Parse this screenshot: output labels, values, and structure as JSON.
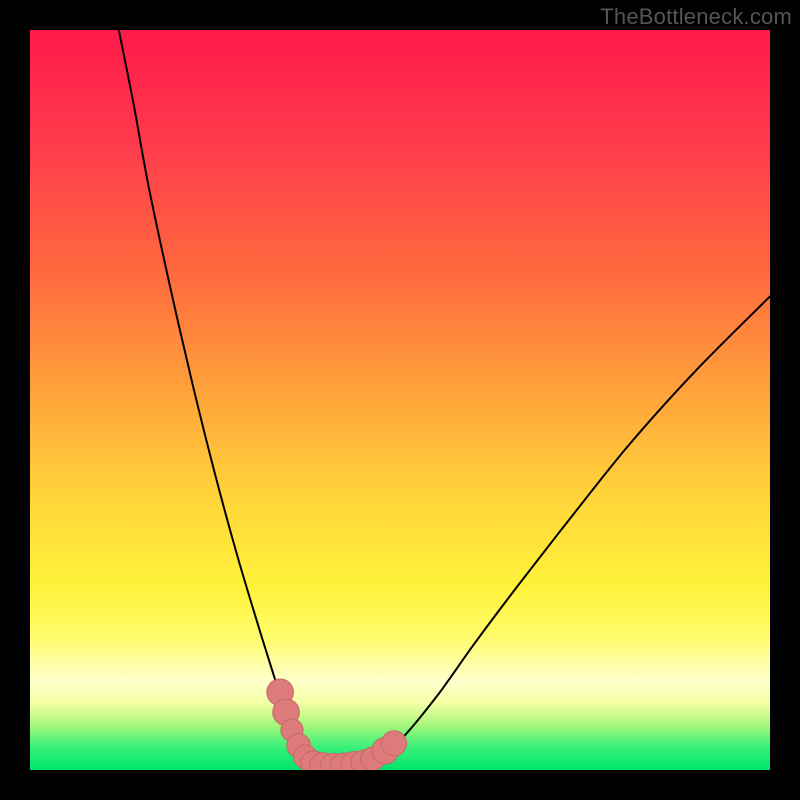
{
  "watermark": "TheBottleneck.com",
  "colors": {
    "curve_stroke": "#000000",
    "beads_fill": "#dd7b7b",
    "beads_stroke": "#c56868"
  },
  "chart_data": {
    "type": "line",
    "title": "",
    "xlabel": "",
    "ylabel": "",
    "xlim": [
      0,
      100
    ],
    "ylim": [
      0,
      100
    ],
    "series": [
      {
        "name": "left-branch",
        "x": [
          12,
          14,
          16,
          19,
          22,
          25,
          28,
          31,
          33.5,
          35,
          36.5,
          38
        ],
        "y": [
          100,
          90,
          79,
          65,
          52,
          40,
          29,
          19,
          11,
          6,
          2.5,
          0.5
        ]
      },
      {
        "name": "valley-floor",
        "x": [
          38,
          40,
          42,
          44,
          46
        ],
        "y": [
          0.5,
          0.3,
          0.3,
          0.5,
          1.0
        ]
      },
      {
        "name": "right-branch",
        "x": [
          46,
          50,
          55,
          60,
          66,
          73,
          81,
          90,
          100
        ],
        "y": [
          1.0,
          4,
          10,
          17,
          25,
          34,
          44,
          54,
          64
        ]
      }
    ],
    "markers": [
      {
        "x": 33.8,
        "y": 10.5,
        "r": 1.8
      },
      {
        "x": 34.6,
        "y": 7.8,
        "r": 1.8
      },
      {
        "x": 35.4,
        "y": 5.4,
        "r": 1.5
      },
      {
        "x": 36.3,
        "y": 3.3,
        "r": 1.6
      },
      {
        "x": 37.2,
        "y": 1.8,
        "r": 1.6
      },
      {
        "x": 38.3,
        "y": 0.9,
        "r": 1.7
      },
      {
        "x": 39.6,
        "y": 0.55,
        "r": 1.8
      },
      {
        "x": 41.0,
        "y": 0.45,
        "r": 1.8
      },
      {
        "x": 42.4,
        "y": 0.5,
        "r": 1.8
      },
      {
        "x": 43.8,
        "y": 0.7,
        "r": 1.8
      },
      {
        "x": 45.1,
        "y": 1.0,
        "r": 1.7
      },
      {
        "x": 46.3,
        "y": 1.5,
        "r": 1.6
      },
      {
        "x": 48.0,
        "y": 2.6,
        "r": 1.8
      },
      {
        "x": 49.2,
        "y": 3.6,
        "r": 1.7
      }
    ]
  }
}
